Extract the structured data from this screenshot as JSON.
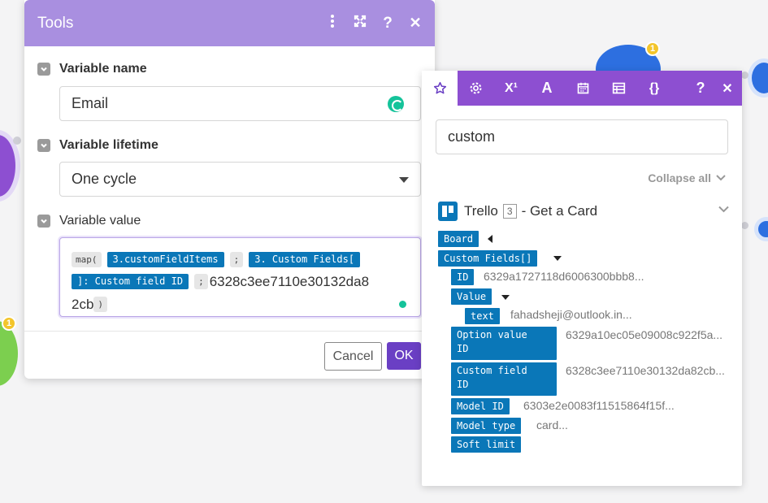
{
  "tools_dialog": {
    "title": "Tools",
    "sections": {
      "variable_name": {
        "label": "Variable name",
        "value": "Email"
      },
      "variable_lifetime": {
        "label": "Variable lifetime",
        "selected": "One cycle"
      },
      "variable_value": {
        "label": "Variable value",
        "tokens": {
          "fn_open": "map(",
          "var1": "3.customFieldItems",
          "sep1": ";",
          "var2a": "3. Custom Fields[",
          "var2b": "]: Custom field ID",
          "sep2": ";",
          "text_a": "6328c3ee7110e30132da8",
          "text_b": "2cb",
          "fn_close": ")"
        }
      }
    },
    "buttons": {
      "cancel": "Cancel",
      "ok": "OK"
    }
  },
  "mapping_panel": {
    "tabs": [
      "favorites",
      "settings",
      "math",
      "text",
      "date",
      "table",
      "json"
    ],
    "math_tab_label": "X¹",
    "text_tab_label": "A",
    "json_tab_label": "{}",
    "search_value": "custom",
    "collapse_all": "Collapse all",
    "module": {
      "name": "Trello",
      "number": "3",
      "action": "- Get a Card"
    },
    "items": {
      "board": "Board",
      "custom_fields": "Custom Fields[]",
      "id": "ID",
      "id_value": "6329a1727118d6006300bbb8...",
      "value": "Value",
      "text": "text",
      "text_value": "fahadsheji@outlook.in...",
      "option_value_id_1": "Option value",
      "option_value_id_2": "ID",
      "option_value_id_value": "6329a10ec05e09008c922f5a...",
      "custom_field_id_1": "Custom field",
      "custom_field_id_2": "ID",
      "custom_field_id_value": "6328c3ee7110e30132da82cb...",
      "model_id": "Model ID",
      "model_id_value": "6303e2e0083f11515864f15f...",
      "model_type": "Model type",
      "model_type_value": "card...",
      "soft_limit": "Soft limit"
    }
  },
  "canvas": {
    "badge_top": "1",
    "badge_left": "1"
  },
  "colors": {
    "header_purple": "#a98fe0",
    "panel_purple": "#8d4fd1",
    "pill_blue": "#0a77b8",
    "ok_button": "#6a3fc4"
  }
}
